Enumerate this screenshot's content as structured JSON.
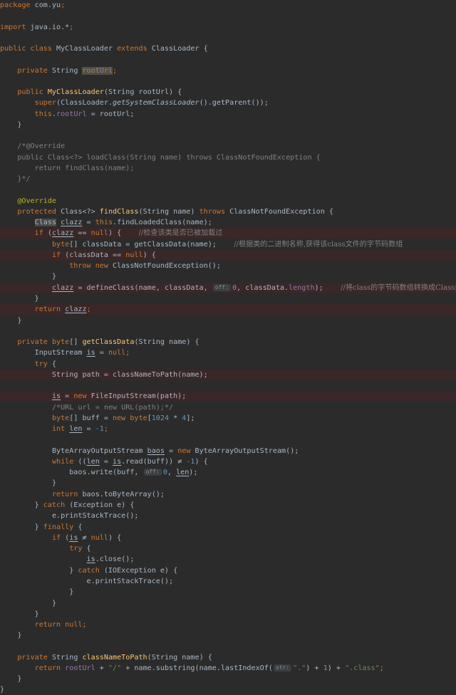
{
  "editor": {
    "hint_offset": "off:",
    "hint_str": "str:",
    "tokens": {
      "package": "package",
      "pkg_name": "com.yu",
      "semi": ";",
      "import": "import",
      "import_path": "java.io.*",
      "public": "public",
      "class": "class",
      "extends": "extends",
      "private": "private",
      "protected": "protected",
      "super": "super",
      "this": "this",
      "new": "new",
      "throw": "throw",
      "throws": "throws",
      "return": "return",
      "null": "null",
      "if": "if",
      "while": "while",
      "try": "try",
      "catch": "catch",
      "finally": "finally",
      "byte": "byte",
      "int": "int",
      "class_name": "MyClassLoader",
      "parent_class": "ClassLoader",
      "string_type": "String",
      "root_url": "rootUrl",
      "class_type": "Class",
      "clazz": "clazz",
      "is_var": "is",
      "len_var": "len",
      "baos_var": "baos",
      "length": "length",
      "override": "@Override",
      "fn_find_class": "findClass",
      "fn_get_class_data": "getClassData",
      "fn_class_name_to_path": "classNameToPath",
      "fn_get_system_loader": "getSystemClassLoader",
      "num_0": "0",
      "num_1024": "1024",
      "num_4": "4",
      "num_1": "1",
      "num_neg1": "-1",
      "str_slash": "\"/\"",
      "str_dot": "\".\"",
      "str_class": "\".class\"",
      "ctor_args": "(String rootUrl) {",
      "ctor_super_open": "(ClassLoader.",
      "ctor_super_close": "().getParent());",
      "assign_root_rhs": " = rootUrl;",
      "close_brace": "}",
      "block_comment_1": "/*@Override",
      "block_comment_2": "public Class<?> loadClass(String name) throws ClassNotFoundException {",
      "block_comment_3": "    return findClass(name);",
      "block_comment_4": "}*/",
      "fc_generic": "<?> ",
      "fc_args": "(String name) ",
      "fc_exception": " ClassNotFoundException {",
      "fc_find_loaded": ".findLoadedClass(name);",
      "eq_null_open": " == ",
      "paren_open": " (",
      "paren_close_brace": ") {",
      "byte_arr": "[] classData = getClassData(name);",
      "comment_check_loaded": "//检查该类是否已被加载过",
      "comment_get_bytes": "//根据类的二进制名称,获得该class文件的字节码数组",
      "class_data_null": " (classData == ",
      "cnfe_new": " ClassNotFoundException();",
      "define_class": " = defineClass(name, classData, ",
      "class_data_len": ", classData.",
      "close_paren_semi": ");",
      "comment_convert": "//将class的字节码数组转换成Class类的实例",
      "gcd_head": "[] ",
      "gcd_args": "(String name) {",
      "input_stream": "InputStream ",
      "assign": " = ",
      "open_brace": " {",
      "path_decl": "String path = classNameToPath(name);",
      "fis_new": " FileInputStream(path);",
      "url_comment": "/*URL url = new URL(path);*/",
      "buff_decl": "[] buff = ",
      "times": " * ",
      "bracket_close_semi": "];",
      "baos_decl": "ByteArrayOutputStream ",
      "baos_new": " ByteArrayOutputStream();",
      "while_open": " ((",
      "read_call": ".read(buff)) ≠ ",
      "write_call": ".write(buff, ",
      "comma": ", ",
      "to_byte_array": " baos.toByteArray();",
      "catch_ex": " (Exception e) {",
      "print_stack": "e.printStackTrace();",
      "neq_null": " ≠ ",
      "close_call": ".close();",
      "catch_io": " (IOException e) {",
      "cntp_args": "(String name) {",
      "plus": " + ",
      "substring_open": " + name.substring(name.lastIndexOf(",
      "plus_one": ") + ",
      "close_paren_plus": ") + ",
      "brace_open_line": " {"
    }
  }
}
